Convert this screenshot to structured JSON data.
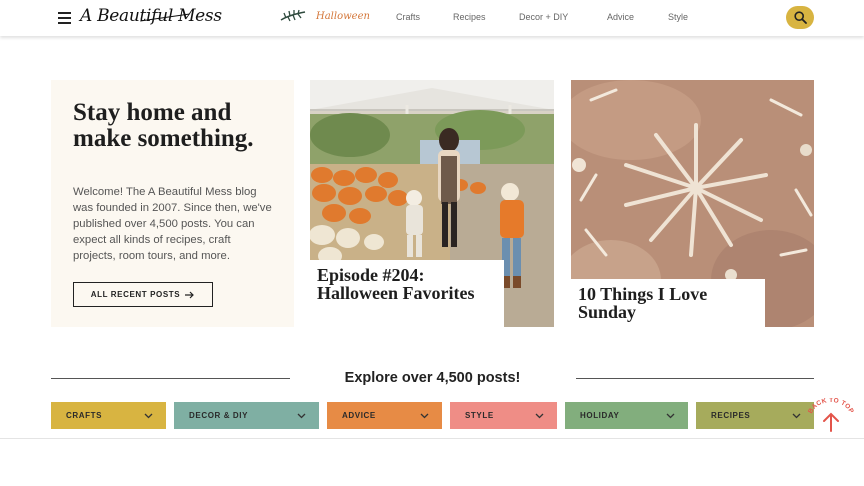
{
  "header": {
    "logo_text": "A Beautiful Mess",
    "nav": [
      {
        "label": "Halloween",
        "icon": "branch-icon",
        "color": "#d4773a"
      },
      {
        "label": "Crafts"
      },
      {
        "label": "Recipes"
      },
      {
        "label": "Decor + DIY"
      },
      {
        "label": "Advice"
      },
      {
        "label": "Style"
      }
    ],
    "search_color": "#d8b441"
  },
  "hero": {
    "title": "Stay home and make something.",
    "body": "Welcome! The A Beautiful Mess blog was founded in 2007. Since then, we've published over 4,500 posts. You can expect all kinds of recipes, craft projects, room tours, and more.",
    "button_label": "ALL RECENT POSTS",
    "background": "#fcf8f1"
  },
  "cards": [
    {
      "title": "Episode #204: Halloween Favorites"
    },
    {
      "title": "10 Things I Love Sunday"
    }
  ],
  "explore": {
    "title": "Explore over 4,500 posts!",
    "categories": [
      {
        "label": "CRAFTS",
        "color": "#d8b441"
      },
      {
        "label": "DECOR & DIY",
        "color": "#7fafa3"
      },
      {
        "label": "ADVICE",
        "color": "#e78b45"
      },
      {
        "label": "STYLE",
        "color": "#ef8d86"
      },
      {
        "label": "HOLIDAY",
        "color": "#82ae7d"
      },
      {
        "label": "RECIPES",
        "color": "#a6ab5c"
      }
    ]
  },
  "back_to_top": {
    "label": "BACK TO TOP",
    "color": "#e3544a"
  }
}
